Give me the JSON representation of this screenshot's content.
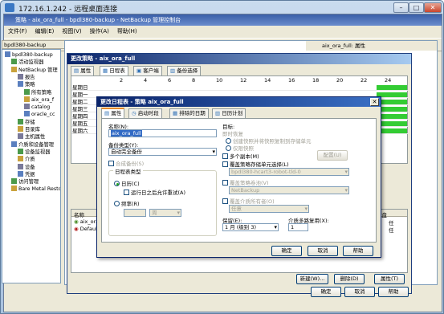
{
  "rdp": {
    "title": "172.16.1.242 - 远程桌面连接"
  },
  "app": {
    "title": "策略 - aix_ora_full - bpdl380-backup - NetBackup 管理控制台",
    "menu": [
      "文件(F)",
      "编辑(E)",
      "视图(V)",
      "操作(A)",
      "帮助(H)"
    ]
  },
  "tree": {
    "header": "bpdl380-backup",
    "items": [
      {
        "label": "bpdl380-backup",
        "indent": 0
      },
      {
        "label": "活动监视器",
        "indent": 1
      },
      {
        "label": "NetBackup 管理",
        "indent": 1
      },
      {
        "label": "报告",
        "indent": 2
      },
      {
        "label": "策略",
        "indent": 2
      },
      {
        "label": "所有策略",
        "indent": 3
      },
      {
        "label": "aix_ora_f",
        "indent": 3
      },
      {
        "label": "catalog",
        "indent": 3
      },
      {
        "label": "oracle_cc",
        "indent": 3
      },
      {
        "label": "存储",
        "indent": 2
      },
      {
        "label": "目录库",
        "indent": 2
      },
      {
        "label": "主机属性",
        "indent": 2
      },
      {
        "label": "介质和设备管理",
        "indent": 1
      },
      {
        "label": "设备监视器",
        "indent": 2
      },
      {
        "label": "介质",
        "indent": 2
      },
      {
        "label": "设备",
        "indent": 2
      },
      {
        "label": "凭据",
        "indent": 2
      },
      {
        "label": "访问管理",
        "indent": 1
      },
      {
        "label": "Bare Metal Resto",
        "indent": 1
      }
    ]
  },
  "mdi": {
    "tab_label": "aix_ora_full: 属性"
  },
  "sched_dialog": {
    "title": "更改策略 - aix_ora_full",
    "tabs": [
      "属性",
      "日程表",
      "客户端",
      "备份选择"
    ],
    "hours": [
      "2",
      "4",
      "6",
      "8",
      "10",
      "12",
      "14",
      "16",
      "18",
      "20",
      "22",
      "24"
    ],
    "days": [
      "星期日",
      "星期一",
      "星期二",
      "星期三",
      "星期四",
      "星期五",
      "星期六"
    ],
    "list_header": "名称",
    "list_items": [
      "aix_ora_f",
      "Default-"
    ],
    "right_header": "磁盘",
    "right_values": [
      "任",
      "任"
    ],
    "new_button": "新建(W)...",
    "delete_button": "删除(D)",
    "props_button": "属性(T)",
    "ok": "确定",
    "cancel": "取消",
    "help": "帮助"
  },
  "modal": {
    "title": "更改日程表 - 策略 aix_ora_full",
    "tabs": [
      "属性",
      "启动时段",
      "排除的日期",
      "日历计划"
    ],
    "name_label": "名称(N):",
    "name_value": "aix_ora_full",
    "backup_type_label": "备份类型(Y):",
    "backup_type_value": "自动完全备份",
    "synthetic_label": "合成备份(S)",
    "schedule_type_group": "日程表类型",
    "calendar_label": "日历(C)",
    "retries_label": "运行日之后允许重试(A)",
    "frequency_label": "频率(R)",
    "frequency_unit": "周",
    "target_label": "目标:",
    "snapshot_label": "即时恢复",
    "snapshot_opt1": "创建快照并将快照复制到存储单元",
    "snapshot_opt2": "仅限快照",
    "config_button": "配置(U)",
    "multi_copies_label": "多个副本(M)",
    "override_storage_label": "覆盖策略存储单元选择(L)",
    "storage_value": "bpdl380-hcart3-robot-tld-0",
    "override_volume_pool_label": "覆盖策略卷池(V)",
    "volume_pool_value": "NetBackup",
    "override_media_owner_label": "覆盖介质所有者(O)",
    "media_owner_value": "任意",
    "retention_label": "保留(E):",
    "retention_value": "1 月 (级别 3)",
    "multiplexing_label": "介质多路复用(X):",
    "multiplexing_value": "1",
    "ok": "确定",
    "cancel": "取消",
    "help": "帮助"
  },
  "colors": {
    "schedule_bar": "#33cc33",
    "title_blue": "#0a246a"
  }
}
